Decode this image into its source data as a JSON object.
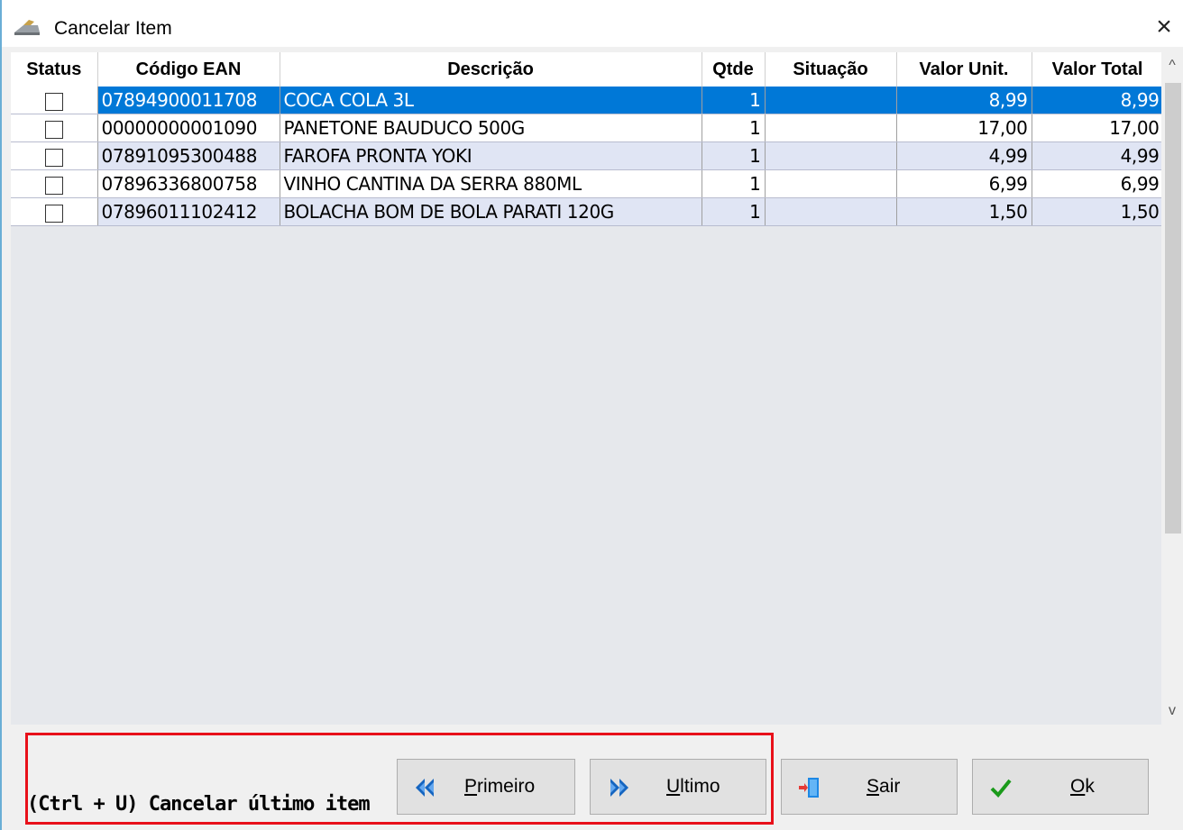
{
  "window": {
    "title": "Cancelar Item",
    "close_glyph": "×"
  },
  "grid": {
    "columns": [
      "Status",
      "Código EAN",
      "Descrição",
      "Qtde",
      "Situação",
      "Valor Unit.",
      "Valor Total"
    ],
    "rows": [
      {
        "ean": "07894900011708",
        "descricao": "COCA COLA 3L",
        "qtde": "1",
        "situacao": "",
        "valor_unit": "8,99",
        "valor_total": "8,99",
        "selected": true
      },
      {
        "ean": "00000000001090",
        "descricao": "PANETONE BAUDUCO 500G",
        "qtde": "1",
        "situacao": "",
        "valor_unit": "17,00",
        "valor_total": "17,00",
        "selected": false
      },
      {
        "ean": "07891095300488",
        "descricao": "FAROFA PRONTA YOKI",
        "qtde": "1",
        "situacao": "",
        "valor_unit": "4,99",
        "valor_total": "4,99",
        "selected": false
      },
      {
        "ean": "07896336800758",
        "descricao": "VINHO CANTINA DA SERRA 880ML",
        "qtde": "1",
        "situacao": "",
        "valor_unit": "6,99",
        "valor_total": "6,99",
        "selected": false
      },
      {
        "ean": "07896011102412",
        "descricao": "BOLACHA BOM DE BOLA PARATI 120G",
        "qtde": "1",
        "situacao": "",
        "valor_unit": "1,50",
        "valor_total": "1,50",
        "selected": false
      }
    ]
  },
  "scrollbar": {
    "up_glyph": "^",
    "down_glyph": "v"
  },
  "footer": {
    "hint": "(Ctrl + U) Cancelar último item",
    "buttons": {
      "primeiro": {
        "mnemonic": "P",
        "rest": "rimeiro",
        "icon": "double-left-arrow-icon"
      },
      "ultimo": {
        "mnemonic": "U",
        "rest": "ltimo",
        "icon": "double-right-arrow-icon"
      },
      "sair": {
        "mnemonic": "S",
        "rest": "air",
        "icon": "exit-door-icon"
      },
      "ok": {
        "mnemonic": "O",
        "rest": "k",
        "icon": "checkmark-icon"
      }
    }
  },
  "colors": {
    "selected_row": "#0078d7",
    "alt_row": "#e0e5f4",
    "highlight_border": "#e8101a",
    "nav_arrow": "#1565c0",
    "check_green": "#1a9a1a"
  }
}
